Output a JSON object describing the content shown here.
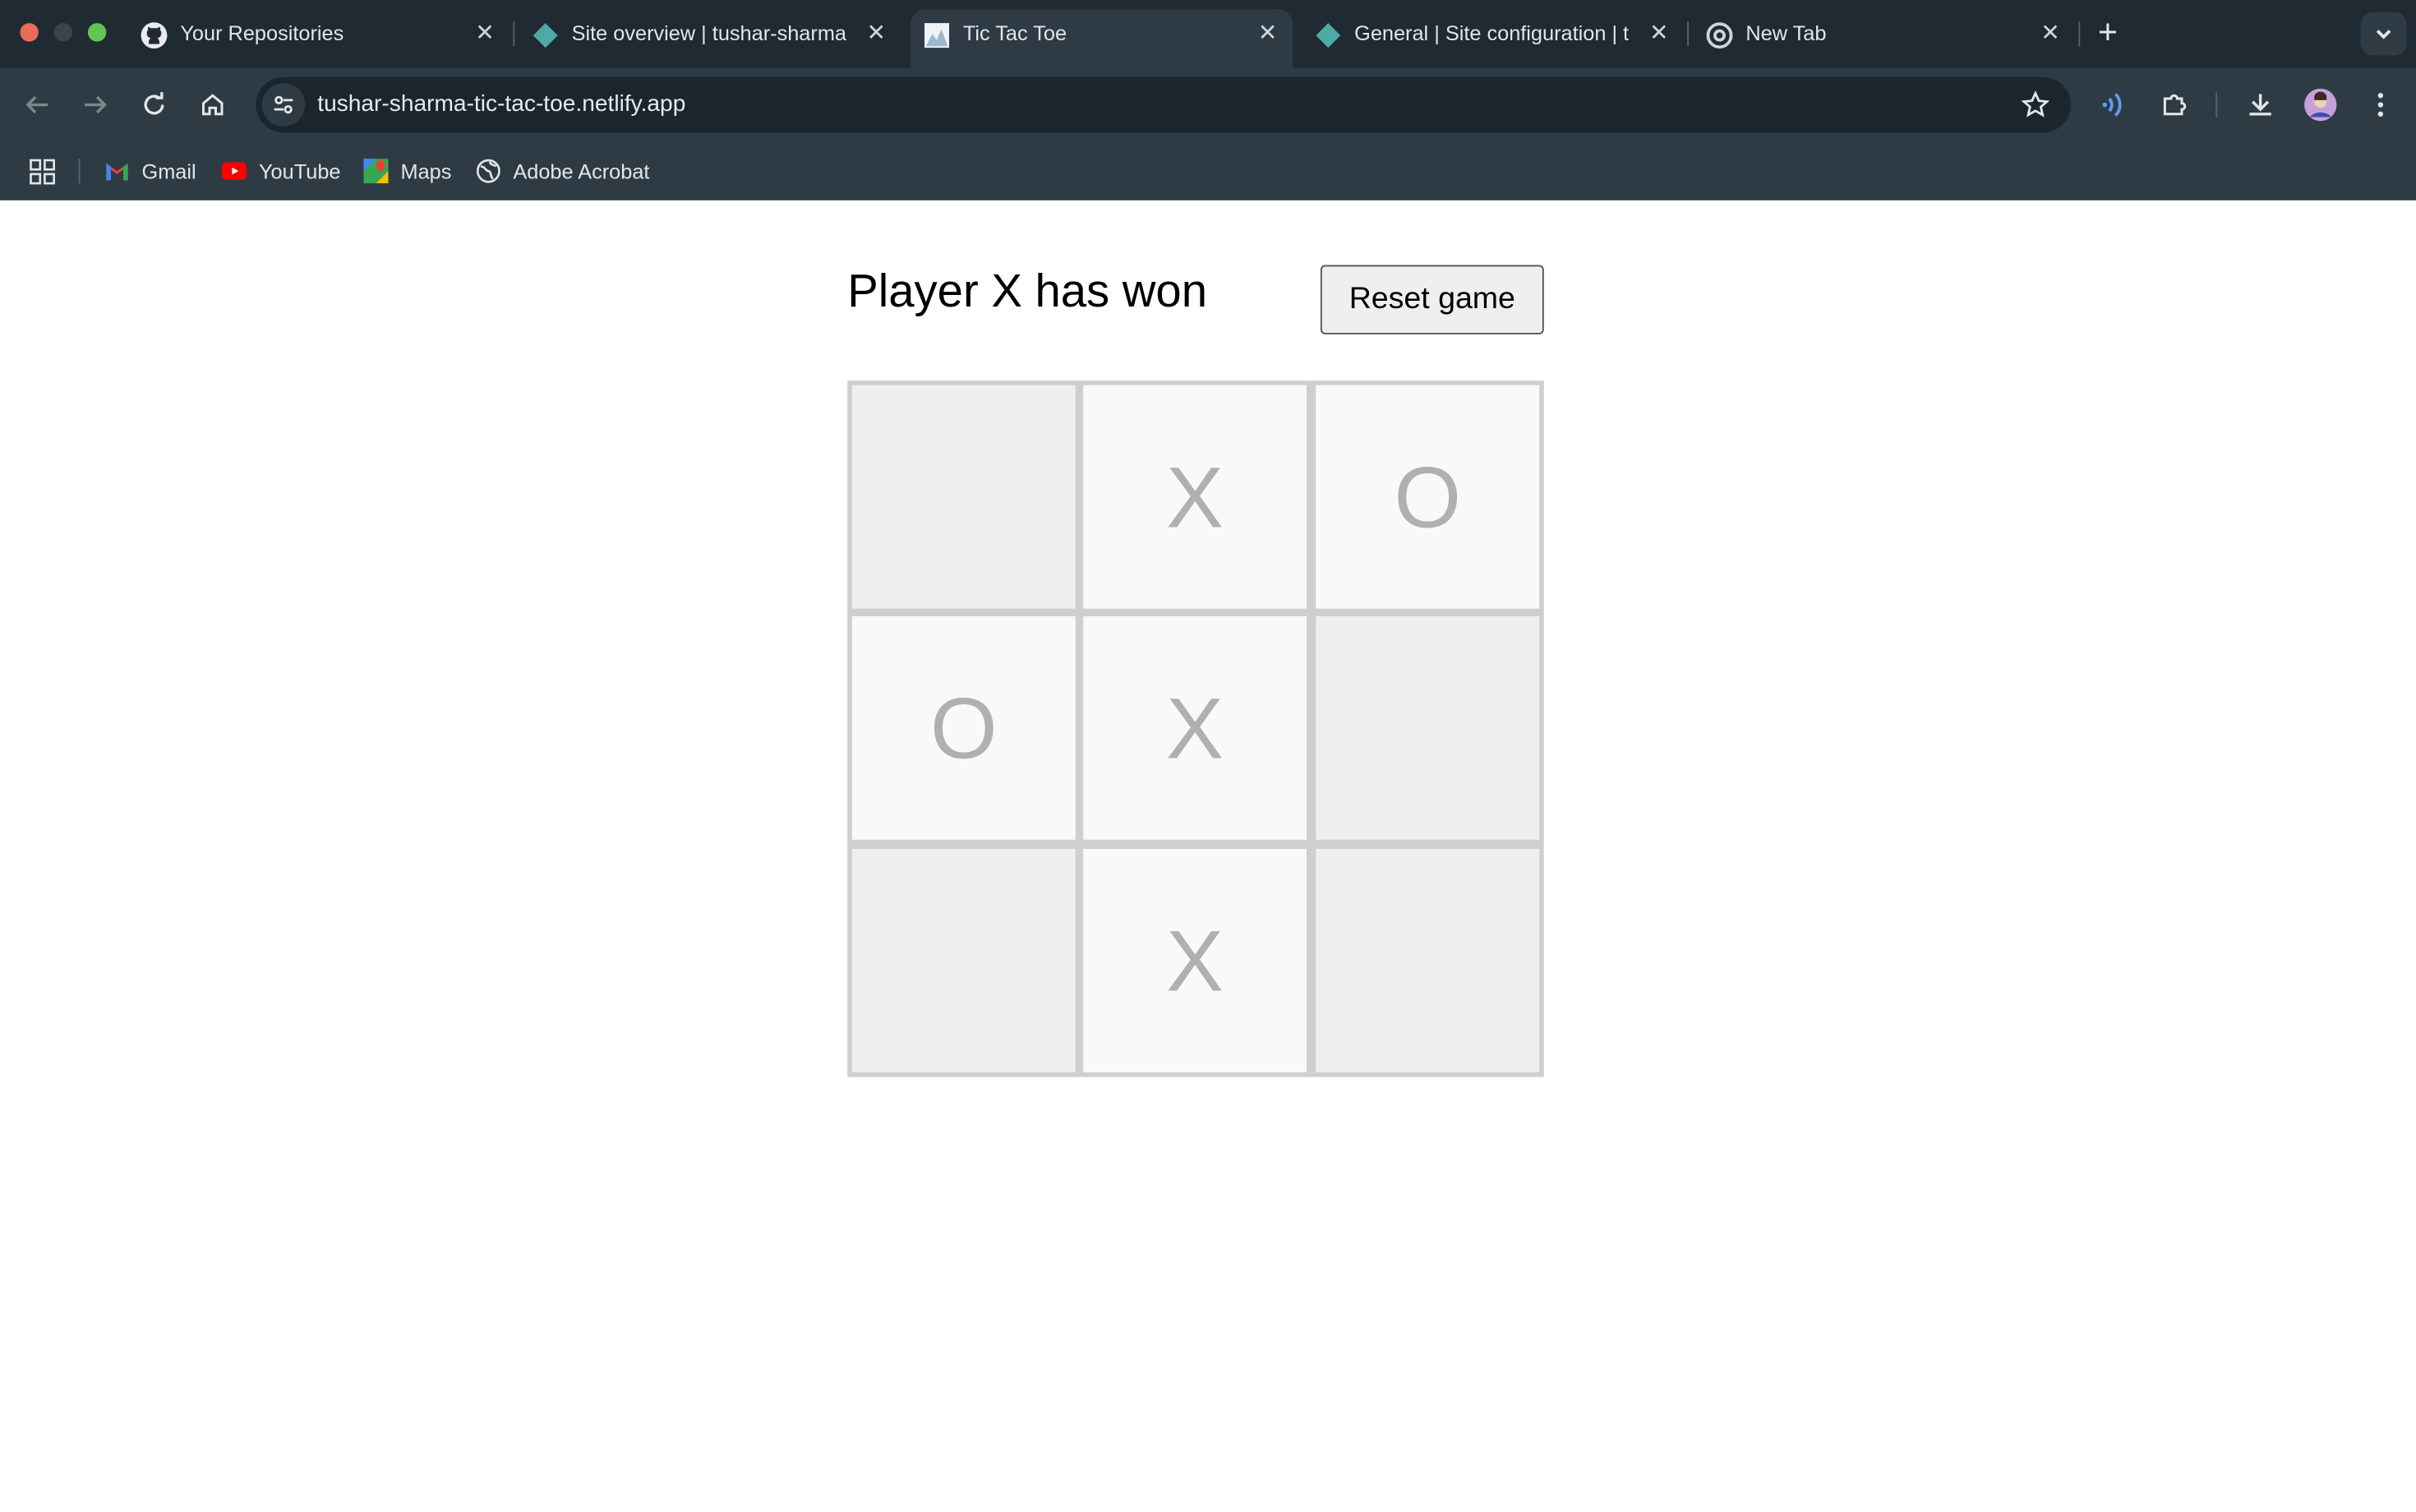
{
  "browser": {
    "tabs": [
      {
        "title": "Your Repositories",
        "icon": "github-icon",
        "active": false
      },
      {
        "title": "Site overview | tushar-sharma",
        "icon": "netlify-icon",
        "active": false
      },
      {
        "title": "Tic Tac Toe",
        "icon": "page-icon",
        "active": true
      },
      {
        "title": "General | Site configuration | t",
        "icon": "netlify-icon",
        "active": false
      },
      {
        "title": "New Tab",
        "icon": "chrome-icon",
        "active": false
      }
    ],
    "new_tab_symbol": "+",
    "close_symbol": "✕",
    "url": "tushar-sharma-tic-tac-toe.netlify.app",
    "bookmarks": [
      {
        "label": "Gmail",
        "icon": "gmail-icon"
      },
      {
        "label": "YouTube",
        "icon": "youtube-icon"
      },
      {
        "label": "Maps",
        "icon": "maps-icon"
      },
      {
        "label": "Adobe Acrobat",
        "icon": "globe-icon"
      }
    ]
  },
  "game": {
    "status": "Player X has won",
    "reset_label": "Reset game",
    "cells": [
      "",
      "X",
      "O",
      "O",
      "X",
      "",
      "",
      "X",
      ""
    ],
    "winning_cells": [
      0,
      0,
      0,
      0,
      0,
      0,
      0,
      0,
      0
    ],
    "colors": {
      "filled_cell": "#f9f9f9",
      "empty_cell": "#efefef",
      "grid": "#cfcfcf",
      "mark": "#b0b0b0"
    }
  }
}
